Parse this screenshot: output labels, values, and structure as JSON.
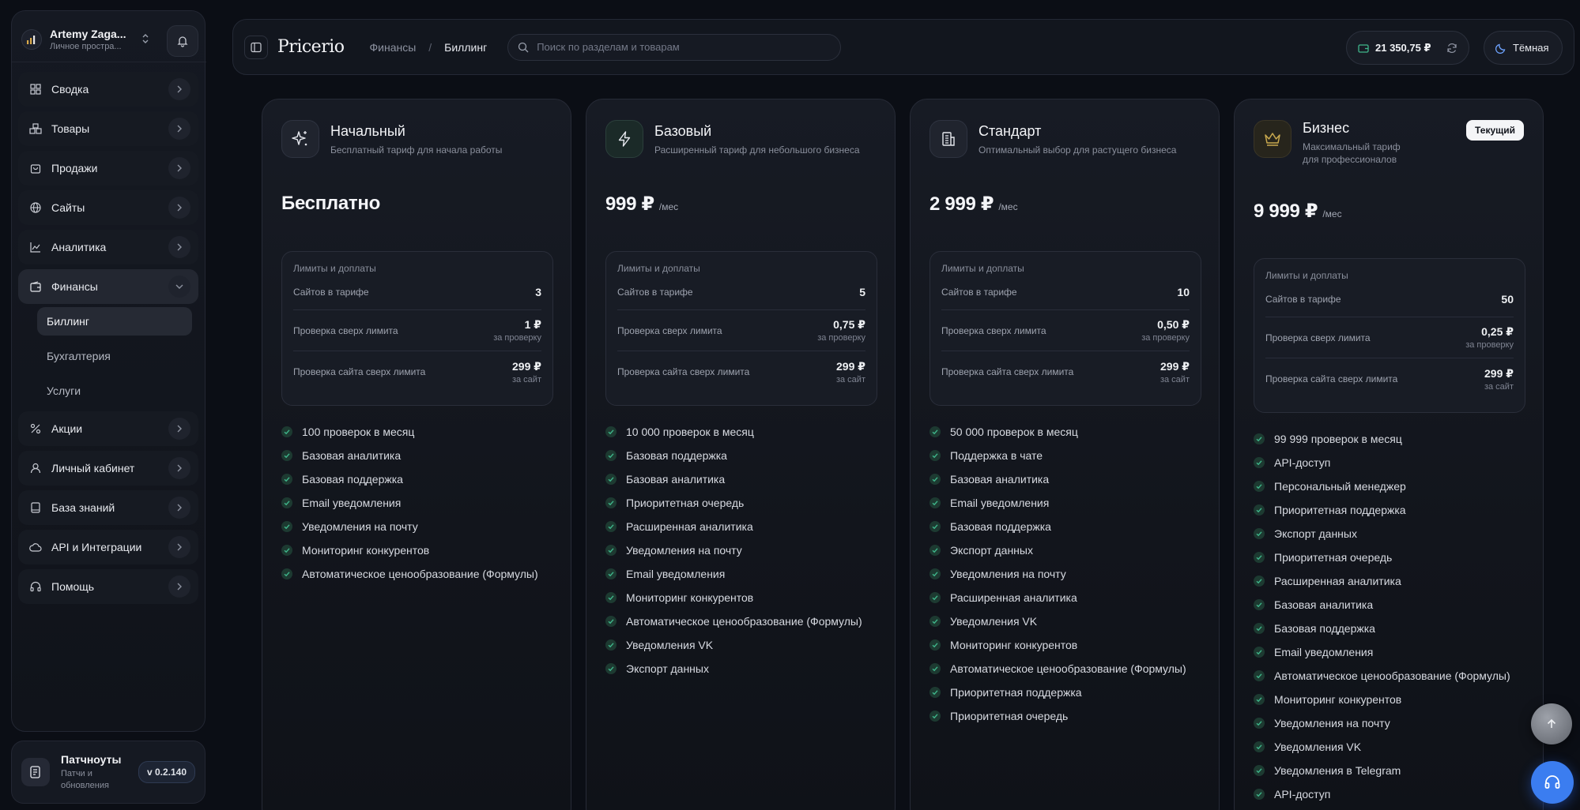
{
  "user": {
    "name": "Artemy Zaga...",
    "workspace": "Личное простра..."
  },
  "sidebar": {
    "items": [
      {
        "label": "Сводка",
        "icon": "dashboard-icon"
      },
      {
        "label": "Товары",
        "icon": "boxes-icon"
      },
      {
        "label": "Продажи",
        "icon": "shopping-bag-icon"
      },
      {
        "label": "Сайты",
        "icon": "globe-icon"
      },
      {
        "label": "Аналитика",
        "icon": "chart-icon"
      },
      {
        "label": "Финансы",
        "icon": "wallet-icon"
      },
      {
        "label": "Акции",
        "icon": "percent-icon"
      },
      {
        "label": "Личный кабинет",
        "icon": "user-icon"
      },
      {
        "label": "База знаний",
        "icon": "book-icon"
      },
      {
        "label": "API и Интеграции",
        "icon": "cloud-icon"
      },
      {
        "label": "Помощь",
        "icon": "headphones-icon"
      }
    ],
    "finance_sub": [
      "Биллинг",
      "Бухгалтерия",
      "Услуги"
    ]
  },
  "patch": {
    "title": "Патчноуты",
    "subtitle": "Патчи и обновления",
    "version": "v 0.2.140"
  },
  "header": {
    "brand": "Pricerio",
    "breadcrumb": [
      "Финансы",
      "Биллинг"
    ],
    "search_placeholder": "Поиск по разделам и товарам",
    "balance": "21 350,75 ₽",
    "theme": "Тёмная"
  },
  "limits_title": "Лимиты и доплаты",
  "limit_labels": [
    "Сайтов в тарифе",
    "Проверка сверх лимита",
    "Проверка сайта сверх лимита"
  ],
  "units": {
    "check": "за проверку",
    "site": "за сайт",
    "per_month": "/мес"
  },
  "current_badge": "Текущий",
  "plans": [
    {
      "name": "Начальный",
      "desc": "Бесплатный тариф для начала работы",
      "price": "Бесплатно",
      "per": "",
      "limits": [
        "3",
        "1 ₽",
        "299 ₽"
      ],
      "features": [
        "100 проверок в месяц",
        "Базовая аналитика",
        "Базовая поддержка",
        "Email уведомления",
        "Уведомления на почту",
        "Мониторинг конкурентов",
        "Автоматическое ценообразование (Формулы)"
      ]
    },
    {
      "name": "Базовый",
      "desc": "Расширенный тариф для небольшого бизнеса",
      "price": "999 ₽",
      "per": "/мес",
      "limits": [
        "5",
        "0,75 ₽",
        "299 ₽"
      ],
      "features": [
        "10 000 проверок в месяц",
        "Базовая поддержка",
        "Базовая аналитика",
        "Приоритетная очередь",
        "Расширенная аналитика",
        "Уведомления на почту",
        "Email уведомления",
        "Мониторинг конкурентов",
        "Автоматическое ценообразование (Формулы)",
        "Уведомления VK",
        "Экспорт данных"
      ]
    },
    {
      "name": "Стандарт",
      "desc": "Оптимальный выбор для растущего бизнеса",
      "price": "2 999 ₽",
      "per": "/мес",
      "limits": [
        "10",
        "0,50 ₽",
        "299 ₽"
      ],
      "features": [
        "50 000 проверок в месяц",
        "Поддержка в чате",
        "Базовая аналитика",
        "Email уведомления",
        "Базовая поддержка",
        "Экспорт данных",
        "Уведомления на почту",
        "Расширенная аналитика",
        "Уведомления VK",
        "Мониторинг конкурентов",
        "Автоматическое ценообразование (Формулы)",
        "Приоритетная поддержка",
        "Приоритетная очередь"
      ]
    },
    {
      "name": "Бизнес",
      "desc": "Максимальный тариф для профессионалов",
      "desc_line1": "Максимальный тариф",
      "desc_line2": "для профессионалов",
      "price": "9 999 ₽",
      "per": "/мес",
      "limits": [
        "50",
        "0,25 ₽",
        "299 ₽"
      ],
      "features": [
        "99 999 проверок в месяц",
        "API-доступ",
        "Персональный менеджер",
        "Приоритетная поддержка",
        "Экспорт данных",
        "Приоритетная очередь",
        "Расширенная аналитика",
        "Базовая аналитика",
        "Базовая поддержка",
        "Email уведомления",
        "Автоматическое ценообразование (Формулы)",
        "Мониторинг конкурентов",
        "Уведомления на почту",
        "Уведомления VK",
        "Уведомления в Telegram",
        "API-доступ"
      ]
    }
  ],
  "colors": {
    "accent_blue": "#3b7df0",
    "check_green": "#3fb68b",
    "gold": "#c9a94e"
  }
}
